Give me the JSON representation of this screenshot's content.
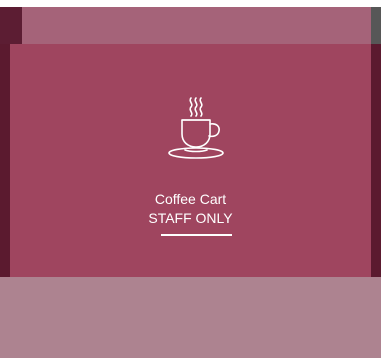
{
  "tile": {
    "title": "Coffee Cart",
    "subtitle": "STAFF ONLY",
    "icon": "coffee-cup-icon"
  },
  "colors": {
    "tile_background": "#9f455f",
    "top_band": "#a56379",
    "bottom_band": "#ad8390",
    "rail": "#5b1a2f",
    "text": "#ffffff"
  }
}
